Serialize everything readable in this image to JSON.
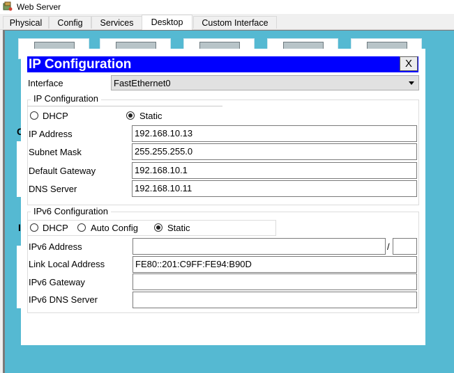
{
  "window": {
    "title": "Web Server"
  },
  "tabs": [
    {
      "label": "Physical"
    },
    {
      "label": "Config"
    },
    {
      "label": "Services"
    },
    {
      "label": "Desktop"
    },
    {
      "label": "Custom Interface"
    }
  ],
  "active_tab": "Desktop",
  "background_fragments": [
    "C",
    "I"
  ],
  "dialog": {
    "title": "IP Configuration",
    "close_label": "X",
    "interface_label": "Interface",
    "interface_value": "FastEthernet0",
    "ipv4": {
      "group_title": "IP Configuration",
      "dhcp_label": "DHCP",
      "static_label": "Static",
      "mode": "Static",
      "fields": [
        {
          "label": "IP Address",
          "value": "192.168.10.13"
        },
        {
          "label": "Subnet Mask",
          "value": "255.255.255.0"
        },
        {
          "label": "Default Gateway",
          "value": "192.168.10.1"
        },
        {
          "label": "DNS Server",
          "value": "192.168.10.11"
        }
      ]
    },
    "ipv6": {
      "group_title": "IPv6 Configuration",
      "dhcp_label": "DHCP",
      "auto_label": "Auto Config",
      "static_label": "Static",
      "mode": "Static",
      "address_label": "IPv6 Address",
      "address_value": "",
      "prefix_separator": "/",
      "prefix_value": "",
      "link_local_label": "Link Local Address",
      "link_local_value": "FE80::201:C9FF:FE94:B90D",
      "gateway_label": "IPv6 Gateway",
      "gateway_value": "",
      "dns_label": "IPv6 DNS Server",
      "dns_value": ""
    }
  },
  "colors": {
    "dialog_header": "#0000ff",
    "desktop_background": "#55b9d2"
  }
}
